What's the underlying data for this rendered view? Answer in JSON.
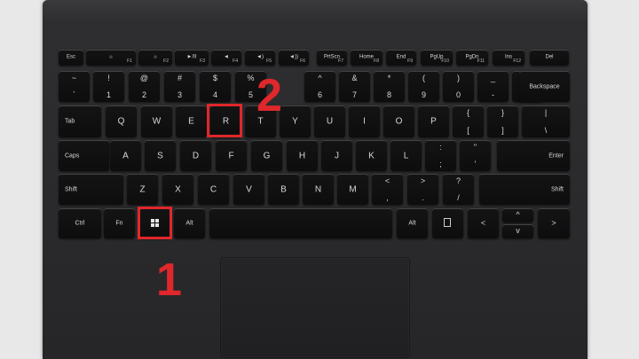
{
  "fn_row": [
    {
      "label": "Esc",
      "fn": ""
    },
    {
      "label": "☼",
      "fn": "F1"
    },
    {
      "label": "☼",
      "fn": "F2"
    },
    {
      "label": "►/II",
      "fn": "F3"
    },
    {
      "label": "◄",
      "fn": "F4"
    },
    {
      "label": "◄)",
      "fn": "F5"
    },
    {
      "label": "◄))",
      "fn": "F6"
    },
    {
      "label": "PrtScn",
      "fn": "F7"
    },
    {
      "label": "Home",
      "fn": "F8"
    },
    {
      "label": "End",
      "fn": "F9"
    },
    {
      "label": "PgUp",
      "fn": "F10"
    },
    {
      "label": "PgDn",
      "fn": "F11"
    },
    {
      "label": "Ins",
      "fn": "F12"
    },
    {
      "label": "Del",
      "fn": ""
    }
  ],
  "num_row": [
    {
      "top": "~",
      "bot": "`"
    },
    {
      "top": "!",
      "bot": "1"
    },
    {
      "top": "@",
      "bot": "2"
    },
    {
      "top": "#",
      "bot": "3"
    },
    {
      "top": "$",
      "bot": "4"
    },
    {
      "top": "%",
      "bot": "5"
    },
    {
      "top": "^",
      "bot": "6"
    },
    {
      "top": "&",
      "bot": "7"
    },
    {
      "top": "*",
      "bot": "8"
    },
    {
      "top": "(",
      "bot": "9"
    },
    {
      "top": ")",
      "bot": "0"
    },
    {
      "top": "_",
      "bot": "-"
    },
    {
      "top": "+",
      "bot": "="
    },
    {
      "label": "Backspace"
    }
  ],
  "q_row": [
    {
      "label": "Tab"
    },
    {
      "label": "Q"
    },
    {
      "label": "W"
    },
    {
      "label": "E"
    },
    {
      "label": "R"
    },
    {
      "label": "T"
    },
    {
      "label": "Y"
    },
    {
      "label": "U"
    },
    {
      "label": "I"
    },
    {
      "label": "O"
    },
    {
      "label": "P"
    },
    {
      "top": "{",
      "bot": "["
    },
    {
      "top": "}",
      "bot": "]"
    },
    {
      "top": "|",
      "bot": "\\"
    }
  ],
  "a_row": [
    {
      "label": "Caps"
    },
    {
      "label": "A"
    },
    {
      "label": "S"
    },
    {
      "label": "D"
    },
    {
      "label": "F"
    },
    {
      "label": "G"
    },
    {
      "label": "H"
    },
    {
      "label": "J"
    },
    {
      "label": "K"
    },
    {
      "label": "L"
    },
    {
      "top": ":",
      "bot": ";"
    },
    {
      "top": "\"",
      "bot": "'"
    },
    {
      "label": "Enter"
    }
  ],
  "z_row": [
    {
      "label": "Shift"
    },
    {
      "label": "Z"
    },
    {
      "label": "X"
    },
    {
      "label": "C"
    },
    {
      "label": "V"
    },
    {
      "label": "B"
    },
    {
      "label": "N"
    },
    {
      "label": "M"
    },
    {
      "top": "<",
      "bot": ","
    },
    {
      "top": ">",
      "bot": "."
    },
    {
      "top": "?",
      "bot": "/"
    },
    {
      "label": "Shift"
    }
  ],
  "bottom_row": {
    "ctrl": "Ctrl",
    "fn": "Fn",
    "alt_left": "Alt",
    "alt_right": "Alt",
    "left": "<",
    "up": "^",
    "down": "v",
    "right": ">"
  },
  "annotations": {
    "step1": "1",
    "step2": "2"
  },
  "colors": {
    "highlight": "#e0272b",
    "key": "#0f0f10",
    "cover": "#2c2c2e",
    "background": "#e8e8e8"
  }
}
